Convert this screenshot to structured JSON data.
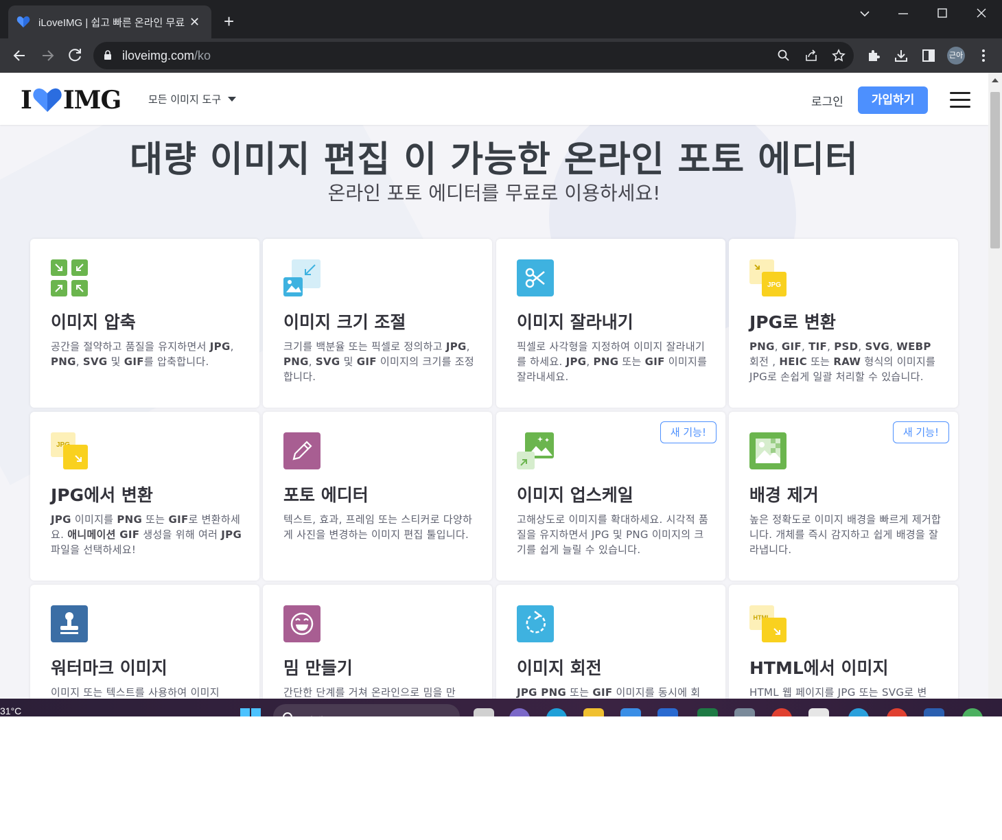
{
  "browser": {
    "tab_title": "iLoveIMG | 쉽고 빠른 온라인 무료",
    "new_tab_symbol": "+",
    "close_symbol": "✕",
    "url_host": "iloveimg.com",
    "url_path": "/ko",
    "profile_label": "근아"
  },
  "header": {
    "logo_left": "I",
    "logo_right": "IMG",
    "tools_menu_label": "모든 이미지 도구",
    "login_label": "로그인",
    "signup_label": "가입하기"
  },
  "hero": {
    "title": "대량 이미지 편집 이 가능한 온라인 포토 에디터",
    "subtitle": "온라인 포토 에디터를 무료로 이용하세요!"
  },
  "badge_label": "새 기능!",
  "tools": [
    {
      "name": "이미지 압축",
      "icon": "compress-icon",
      "color": "#6bb54e",
      "desc_parts": [
        [
          "공간을 절약하고 품질을 유지하면서 ",
          false
        ],
        [
          "JPG",
          true
        ],
        [
          ", ",
          false
        ],
        [
          "PNG",
          true
        ],
        [
          ", ",
          false
        ],
        [
          "SVG",
          true
        ],
        [
          " 및 ",
          false
        ],
        [
          "GIF",
          true
        ],
        [
          "를 압축합니다.",
          false
        ]
      ]
    },
    {
      "name": "이미지 크기 조절",
      "icon": "resize-icon",
      "color": "#3eb2e0",
      "desc_parts": [
        [
          "크기를 백분율 또는 픽셀로 정의하고 ",
          false
        ],
        [
          "JPG",
          true
        ],
        [
          ", ",
          false
        ],
        [
          "PNG",
          true
        ],
        [
          ", ",
          false
        ],
        [
          "SVG",
          true
        ],
        [
          " 및 ",
          false
        ],
        [
          "GIF",
          true
        ],
        [
          " 이미지의 크기를 조정합니다.",
          false
        ]
      ]
    },
    {
      "name": "이미지 잘라내기",
      "icon": "scissors-icon",
      "color": "#3eb2e0",
      "desc_parts": [
        [
          "픽셀로 사각형을 지정하여 이미지 잘라내기를 하세요. ",
          false
        ],
        [
          "JPG",
          true
        ],
        [
          ", ",
          false
        ],
        [
          "PNG",
          true
        ],
        [
          " 또는 ",
          false
        ],
        [
          "GIF",
          true
        ],
        [
          " 이미지를 잘라내세요.",
          false
        ]
      ]
    },
    {
      "name": "JPG로 변환",
      "icon": "to-jpg-icon",
      "color": "#f9d11f",
      "desc_parts": [
        [
          "PNG",
          true
        ],
        [
          ", ",
          false
        ],
        [
          "GIF",
          true
        ],
        [
          ", ",
          false
        ],
        [
          "TIF",
          true
        ],
        [
          ", ",
          false
        ],
        [
          "PSD",
          true
        ],
        [
          ", ",
          false
        ],
        [
          "SVG",
          true
        ],
        [
          ", ",
          false
        ],
        [
          "WEBP",
          true
        ],
        [
          " 회전 , ",
          false
        ],
        [
          "HEIC",
          true
        ],
        [
          " 또는 ",
          false
        ],
        [
          "RAW",
          true
        ],
        [
          " 형식의 이미지를 JPG로 손쉽게 일괄 처리할 수 있습니다.",
          false
        ]
      ]
    },
    {
      "name": "JPG에서 변환",
      "icon": "from-jpg-icon",
      "color": "#f9d11f",
      "desc_parts": [
        [
          "JPG",
          true
        ],
        [
          " 이미지를 ",
          false
        ],
        [
          "PNG",
          true
        ],
        [
          " 또는 ",
          false
        ],
        [
          "GIF",
          true
        ],
        [
          "로 변환하세요. ",
          false
        ],
        [
          "애니메이션 GIF",
          true
        ],
        [
          " 생성을 위해 여러 ",
          false
        ],
        [
          "JPG",
          true
        ],
        [
          " 파일을 선택하세요!",
          false
        ]
      ]
    },
    {
      "name": "포토 에디터",
      "icon": "pencil-icon",
      "color": "#a85e92",
      "desc_parts": [
        [
          "텍스트, 효과, 프레임 또는 스티커로 다양하게 사진을 변경하는 이미지 편집 툴입니다.",
          false
        ]
      ]
    },
    {
      "name": "이미지 업스케일",
      "icon": "upscale-icon",
      "color": "#6bb54e",
      "badge": true,
      "desc_parts": [
        [
          "고해상도로 이미지를 확대하세요. 시각적 품질을 유지하면서 JPG 및 PNG 이미지의 크기를 쉽게 늘릴 수 있습니다.",
          false
        ]
      ]
    },
    {
      "name": "배경 제거",
      "icon": "remove-bg-icon",
      "color": "#6bb54e",
      "badge": true,
      "desc_parts": [
        [
          "높은 정확도로 이미지 배경을 빠르게 제거합니다. 개체를 즉시 감지하고 쉽게 배경을 잘라냅니다.",
          false
        ]
      ]
    },
    {
      "name": "워터마크 이미지",
      "icon": "stamp-icon",
      "color": "#3b6ea5",
      "desc_parts": [
        [
          "이미지 또는 텍스트를 사용하여 이미지",
          false
        ]
      ]
    },
    {
      "name": "밈 만들기",
      "icon": "meme-icon",
      "color": "#a85e92",
      "desc_parts": [
        [
          "간단한 단계를 거쳐 온라인으로 밈을 만",
          false
        ]
      ]
    },
    {
      "name": "이미지 회전",
      "icon": "rotate-icon",
      "color": "#3eb2e0",
      "desc_parts": [
        [
          "JPG PNG",
          true
        ],
        [
          " 또는 ",
          false
        ],
        [
          "GIF",
          true
        ],
        [
          " 이미지를 동시에 회",
          false
        ]
      ]
    },
    {
      "name": "HTML에서 이미지",
      "icon": "html-icon",
      "color": "#f9d11f",
      "desc_parts": [
        [
          "HTML 웹 페이지를 JPG 또는 SVG로 변",
          false
        ]
      ]
    }
  ],
  "taskbar": {
    "temperature": "31°C",
    "search_placeholder": "검색"
  }
}
